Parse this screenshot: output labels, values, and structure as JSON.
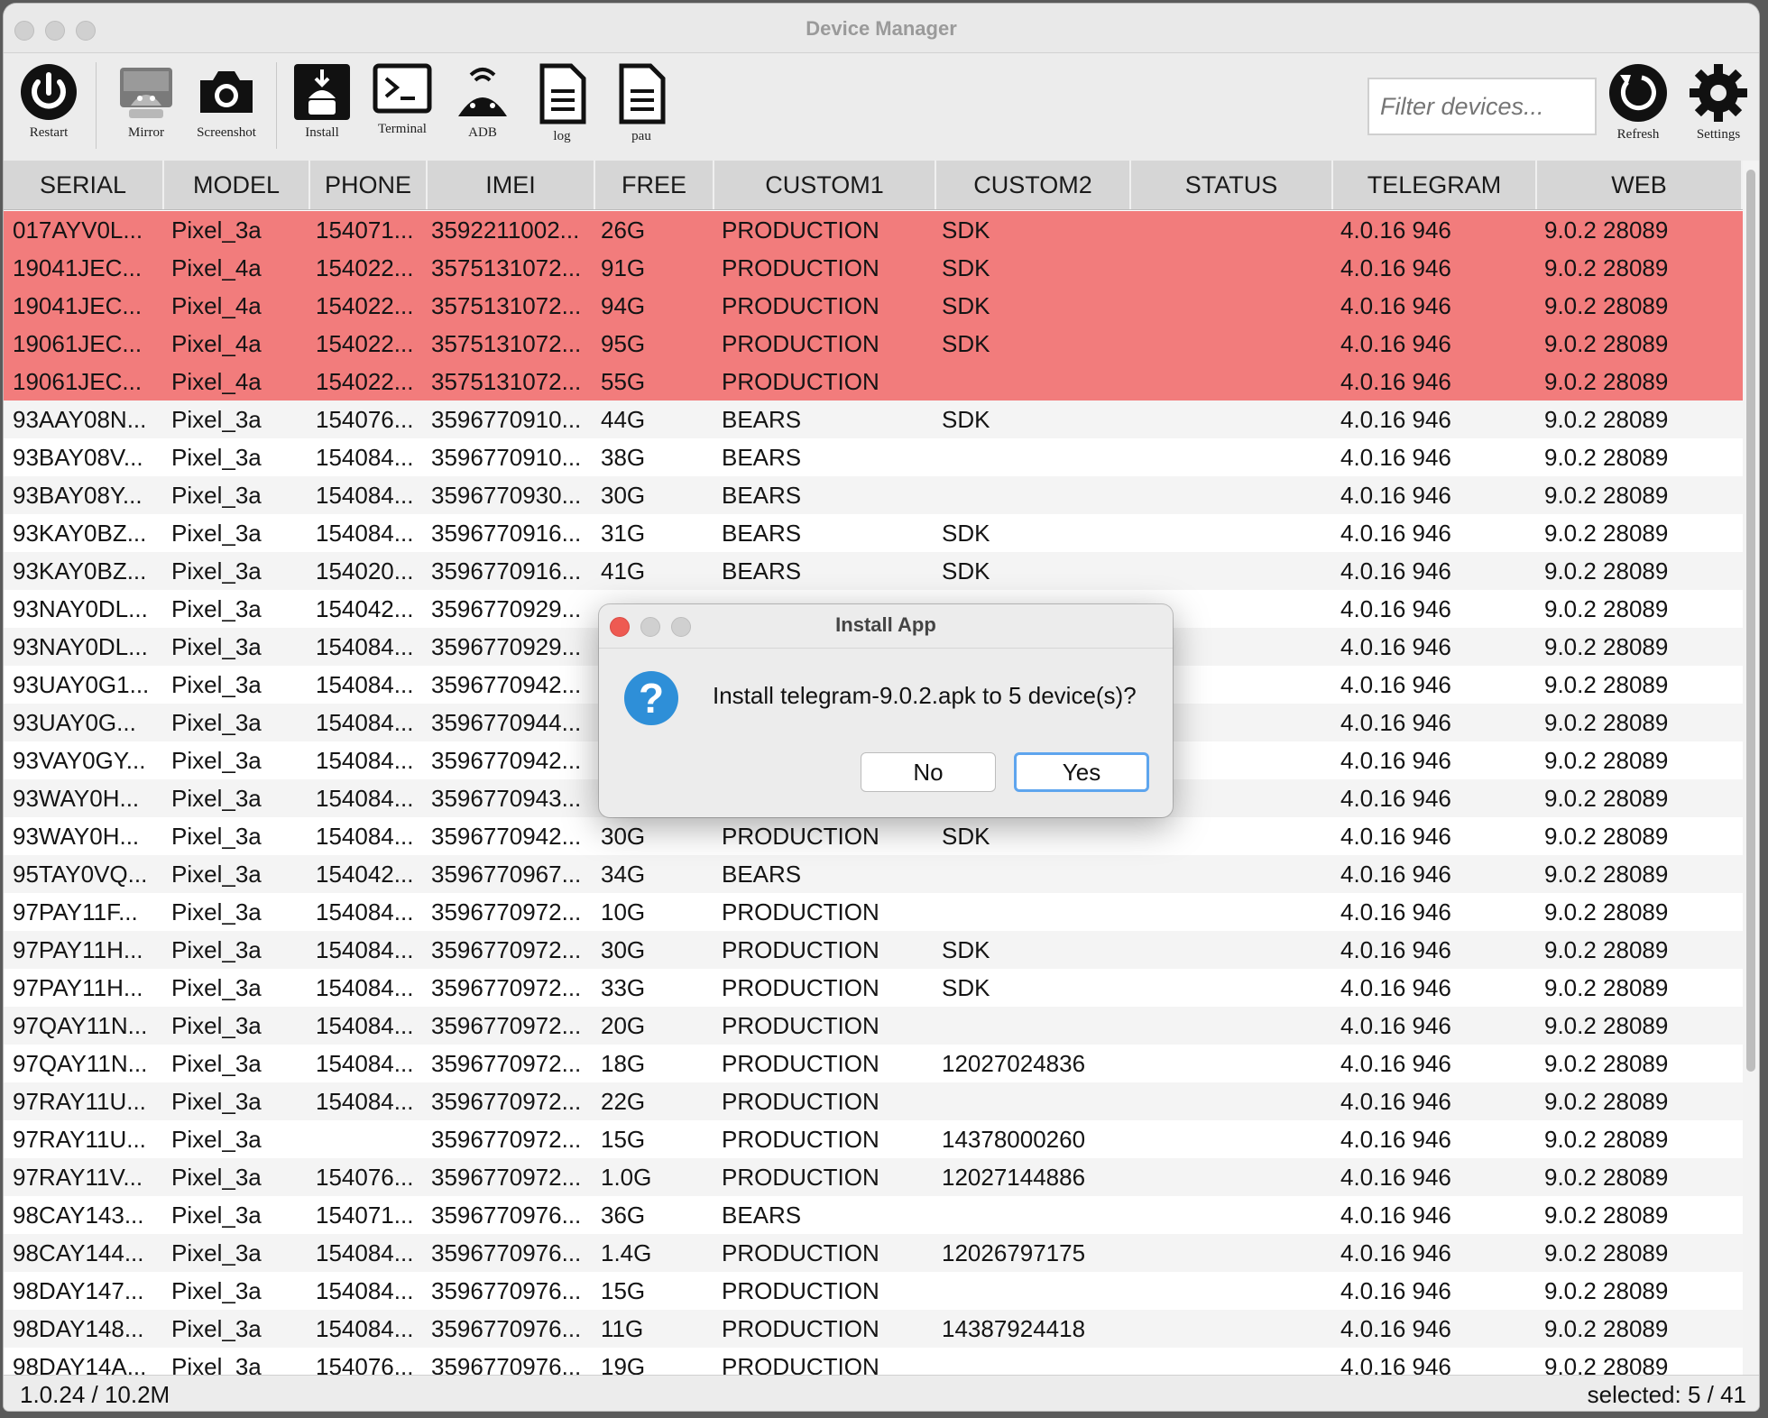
{
  "window": {
    "title": "Device Manager"
  },
  "toolbar": {
    "restart": "Restart",
    "mirror": "Mirror",
    "screenshot": "Screenshot",
    "install": "Install",
    "terminal": "Terminal",
    "adb": "ADB",
    "log": "log",
    "pau": "pau",
    "refresh": "Refresh",
    "settings": "Settings",
    "filter_placeholder": "Filter devices..."
  },
  "table": {
    "columns": [
      "SERIAL",
      "MODEL",
      "PHONE",
      "IMEI",
      "FREE",
      "CUSTOM1",
      "CUSTOM2",
      "STATUS",
      "TELEGRAM",
      "WEB"
    ],
    "rows": [
      {
        "serial": "017AYV0L...",
        "model": "Pixel_3a",
        "phone": "154071...",
        "imei": "3592211002...",
        "free": "26G",
        "custom1": "PRODUCTION",
        "custom2": "SDK",
        "status": "",
        "telegram": "4.0.16 946",
        "web": "9.0.2 28089",
        "selected": true
      },
      {
        "serial": "19041JEC...",
        "model": "Pixel_4a",
        "phone": "154022...",
        "imei": "3575131072...",
        "free": "91G",
        "custom1": "PRODUCTION",
        "custom2": "SDK",
        "status": "",
        "telegram": "4.0.16 946",
        "web": "9.0.2 28089",
        "selected": true
      },
      {
        "serial": "19041JEC...",
        "model": "Pixel_4a",
        "phone": "154022...",
        "imei": "3575131072...",
        "free": "94G",
        "custom1": "PRODUCTION",
        "custom2": "SDK",
        "status": "",
        "telegram": "4.0.16 946",
        "web": "9.0.2 28089",
        "selected": true
      },
      {
        "serial": "19061JEC...",
        "model": "Pixel_4a",
        "phone": "154022...",
        "imei": "3575131072...",
        "free": "95G",
        "custom1": "PRODUCTION",
        "custom2": "SDK",
        "status": "",
        "telegram": "4.0.16 946",
        "web": "9.0.2 28089",
        "selected": true
      },
      {
        "serial": "19061JEC...",
        "model": "Pixel_4a",
        "phone": "154022...",
        "imei": "3575131072...",
        "free": "55G",
        "custom1": "PRODUCTION",
        "custom2": "",
        "status": "",
        "telegram": "4.0.16 946",
        "web": "9.0.2 28089",
        "selected": true
      },
      {
        "serial": "93AAY08N...",
        "model": "Pixel_3a",
        "phone": "154076...",
        "imei": "3596770910...",
        "free": "44G",
        "custom1": "BEARS",
        "custom2": "SDK",
        "status": "",
        "telegram": "4.0.16 946",
        "web": "9.0.2 28089"
      },
      {
        "serial": "93BAY08V...",
        "model": "Pixel_3a",
        "phone": "154084...",
        "imei": "3596770910...",
        "free": "38G",
        "custom1": "BEARS",
        "custom2": "",
        "status": "",
        "telegram": "4.0.16 946",
        "web": "9.0.2 28089"
      },
      {
        "serial": "93BAY08Y...",
        "model": "Pixel_3a",
        "phone": "154084...",
        "imei": "3596770930...",
        "free": "30G",
        "custom1": "BEARS",
        "custom2": "",
        "status": "",
        "telegram": "4.0.16 946",
        "web": "9.0.2 28089"
      },
      {
        "serial": "93KAY0BZ...",
        "model": "Pixel_3a",
        "phone": "154084...",
        "imei": "3596770916...",
        "free": "31G",
        "custom1": "BEARS",
        "custom2": "SDK",
        "status": "",
        "telegram": "4.0.16 946",
        "web": "9.0.2 28089"
      },
      {
        "serial": "93KAY0BZ...",
        "model": "Pixel_3a",
        "phone": "154020...",
        "imei": "3596770916...",
        "free": "41G",
        "custom1": "BEARS",
        "custom2": "SDK",
        "status": "",
        "telegram": "4.0.16 946",
        "web": "9.0.2 28089"
      },
      {
        "serial": "93NAY0DL...",
        "model": "Pixel_3a",
        "phone": "154042...",
        "imei": "3596770929...",
        "free": "",
        "custom1": "",
        "custom2": "",
        "status": "",
        "telegram": "4.0.16 946",
        "web": "9.0.2 28089"
      },
      {
        "serial": "93NAY0DL...",
        "model": "Pixel_3a",
        "phone": "154084...",
        "imei": "3596770929...",
        "free": "",
        "custom1": "",
        "custom2": "",
        "status": "",
        "telegram": "4.0.16 946",
        "web": "9.0.2 28089"
      },
      {
        "serial": "93UAY0G1...",
        "model": "Pixel_3a",
        "phone": "154084...",
        "imei": "3596770942...",
        "free": "",
        "custom1": "",
        "custom2": "",
        "status": "",
        "telegram": "4.0.16 946",
        "web": "9.0.2 28089"
      },
      {
        "serial": "93UAY0G...",
        "model": "Pixel_3a",
        "phone": "154084...",
        "imei": "3596770944...",
        "free": "",
        "custom1": "",
        "custom2": "",
        "status": "",
        "telegram": "4.0.16 946",
        "web": "9.0.2 28089"
      },
      {
        "serial": "93VAY0GY...",
        "model": "Pixel_3a",
        "phone": "154084...",
        "imei": "3596770942...",
        "free": "",
        "custom1": "",
        "custom2": "",
        "status": "",
        "telegram": "4.0.16 946",
        "web": "9.0.2 28089"
      },
      {
        "serial": "93WAY0H...",
        "model": "Pixel_3a",
        "phone": "154084...",
        "imei": "3596770943...",
        "free": "",
        "custom1": "",
        "custom2": "",
        "status": "",
        "telegram": "4.0.16 946",
        "web": "9.0.2 28089"
      },
      {
        "serial": "93WAY0H...",
        "model": "Pixel_3a",
        "phone": "154084...",
        "imei": "3596770942...",
        "free": "30G",
        "custom1": "PRODUCTION",
        "custom2": "SDK",
        "status": "",
        "telegram": "4.0.16 946",
        "web": "9.0.2 28089"
      },
      {
        "serial": "95TAY0VQ...",
        "model": "Pixel_3a",
        "phone": "154042...",
        "imei": "3596770967...",
        "free": "34G",
        "custom1": "BEARS",
        "custom2": "",
        "status": "",
        "telegram": "4.0.16 946",
        "web": "9.0.2 28089"
      },
      {
        "serial": "97PAY11F...",
        "model": "Pixel_3a",
        "phone": "154084...",
        "imei": "3596770972...",
        "free": "10G",
        "custom1": "PRODUCTION",
        "custom2": "",
        "status": "",
        "telegram": "4.0.16 946",
        "web": "9.0.2 28089"
      },
      {
        "serial": "97PAY11H...",
        "model": "Pixel_3a",
        "phone": "154084...",
        "imei": "3596770972...",
        "free": "30G",
        "custom1": "PRODUCTION",
        "custom2": "SDK",
        "status": "",
        "telegram": "4.0.16 946",
        "web": "9.0.2 28089"
      },
      {
        "serial": "97PAY11H...",
        "model": "Pixel_3a",
        "phone": "154084...",
        "imei": "3596770972...",
        "free": "33G",
        "custom1": "PRODUCTION",
        "custom2": "SDK",
        "status": "",
        "telegram": "4.0.16 946",
        "web": "9.0.2 28089"
      },
      {
        "serial": "97QAY11N...",
        "model": "Pixel_3a",
        "phone": "154084...",
        "imei": "3596770972...",
        "free": "20G",
        "custom1": "PRODUCTION",
        "custom2": "",
        "status": "",
        "telegram": "4.0.16 946",
        "web": "9.0.2 28089"
      },
      {
        "serial": "97QAY11N...",
        "model": "Pixel_3a",
        "phone": "154084...",
        "imei": "3596770972...",
        "free": "18G",
        "custom1": "PRODUCTION",
        "custom2": "12027024836",
        "status": "",
        "telegram": "4.0.16 946",
        "web": "9.0.2 28089"
      },
      {
        "serial": "97RAY11U...",
        "model": "Pixel_3a",
        "phone": "154084...",
        "imei": "3596770972...",
        "free": "22G",
        "custom1": "PRODUCTION",
        "custom2": "",
        "status": "",
        "telegram": "4.0.16 946",
        "web": "9.0.2 28089"
      },
      {
        "serial": "97RAY11U...",
        "model": "Pixel_3a",
        "phone": "",
        "imei": "3596770972...",
        "free": "15G",
        "custom1": "PRODUCTION",
        "custom2": "14378000260",
        "status": "",
        "telegram": "4.0.16 946",
        "web": "9.0.2 28089"
      },
      {
        "serial": "97RAY11V...",
        "model": "Pixel_3a",
        "phone": "154076...",
        "imei": "3596770972...",
        "free": "1.0G",
        "custom1": "PRODUCTION",
        "custom2": "12027144886",
        "status": "",
        "telegram": "4.0.16 946",
        "web": "9.0.2 28089"
      },
      {
        "serial": "98CAY143...",
        "model": "Pixel_3a",
        "phone": "154071...",
        "imei": "3596770976...",
        "free": "36G",
        "custom1": "BEARS",
        "custom2": "",
        "status": "",
        "telegram": "4.0.16 946",
        "web": "9.0.2 28089"
      },
      {
        "serial": "98CAY144...",
        "model": "Pixel_3a",
        "phone": "154084...",
        "imei": "3596770976...",
        "free": "1.4G",
        "custom1": "PRODUCTION",
        "custom2": "12026797175",
        "status": "",
        "telegram": "4.0.16 946",
        "web": "9.0.2 28089"
      },
      {
        "serial": "98DAY147...",
        "model": "Pixel_3a",
        "phone": "154084...",
        "imei": "3596770976...",
        "free": "15G",
        "custom1": "PRODUCTION",
        "custom2": "",
        "status": "",
        "telegram": "4.0.16 946",
        "web": "9.0.2 28089"
      },
      {
        "serial": "98DAY148...",
        "model": "Pixel_3a",
        "phone": "154084...",
        "imei": "3596770976...",
        "free": "11G",
        "custom1": "PRODUCTION",
        "custom2": "14387924418",
        "status": "",
        "telegram": "4.0.16 946",
        "web": "9.0.2 28089"
      },
      {
        "serial": "98DAY14A...",
        "model": "Pixel_3a",
        "phone": "154076...",
        "imei": "3596770976...",
        "free": "19G",
        "custom1": "PRODUCTION",
        "custom2": "",
        "status": "",
        "telegram": "4.0.16 946",
        "web": "9.0.2 28089"
      }
    ]
  },
  "status": {
    "version": "1.0.24 / 10.2M",
    "selection": "selected: 5 / 41"
  },
  "dialog": {
    "title": "Install App",
    "message": "Install telegram-9.0.2.apk to 5 device(s)?",
    "no": "No",
    "yes": "Yes"
  },
  "colors": {
    "selected_row": "#f27c7c",
    "accent": "#5ea5ee",
    "question_icon": "#2e8fd8"
  }
}
